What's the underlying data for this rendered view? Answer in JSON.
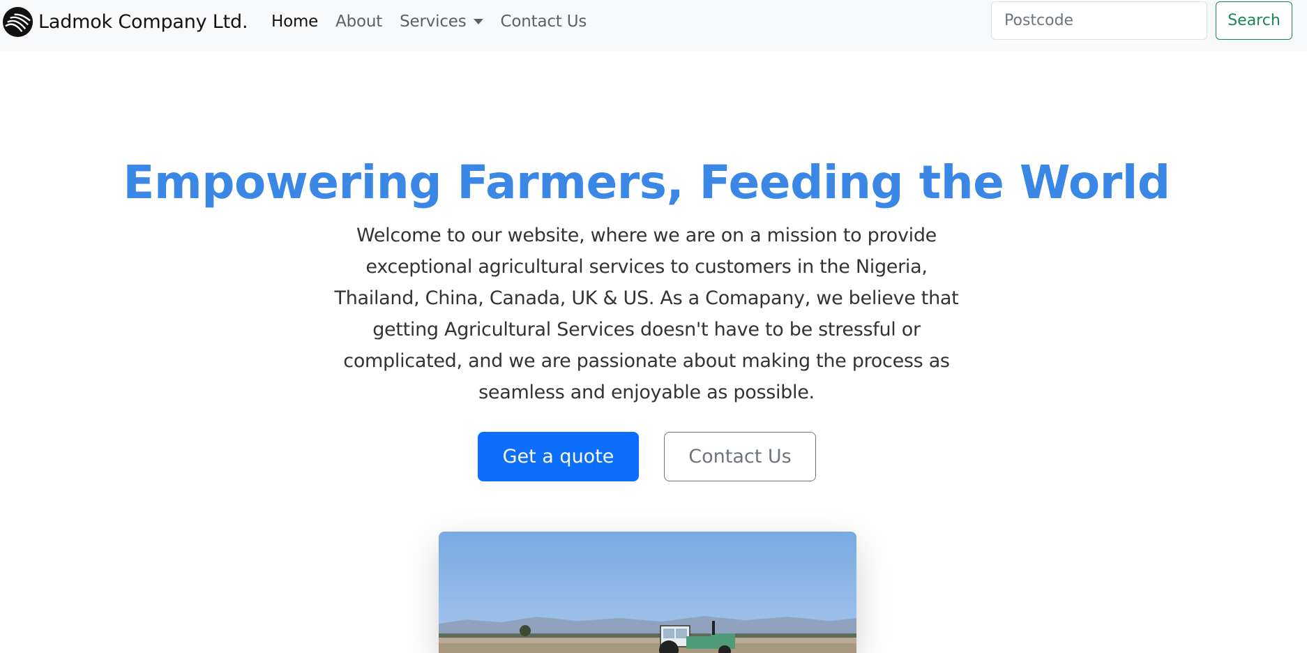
{
  "navbar": {
    "brand": "Ladmok Company Ltd.",
    "links": [
      {
        "label": "Home",
        "active": true
      },
      {
        "label": "About",
        "active": false
      },
      {
        "label": "Services",
        "active": false,
        "dropdown": true
      },
      {
        "label": "Contact Us",
        "active": false
      }
    ],
    "search": {
      "placeholder": "Postcode",
      "button_label": "Search"
    }
  },
  "hero": {
    "title": "Empowering Farmers, Feeding the World",
    "description": "Welcome to our website, where we are on a mission to provide exceptional agricultural services to customers in the Nigeria, Thailand, China, Canada, UK & US. As a Comapany, we believe that getting Agricultural Services doesn't have to be stressful or complicated, and we are passionate about making the process as seamless and enjoyable as possible.",
    "primary_button": "Get a quote",
    "secondary_button": "Contact Us"
  },
  "icons": {
    "brand_logo": "brand-logo-icon",
    "dropdown": "caret-down-icon"
  },
  "colors": {
    "title": "#3b87e6",
    "primary": "#0d6efd",
    "success": "#198754",
    "secondary": "#6c757d",
    "navbar_bg": "#f8f9fa"
  }
}
